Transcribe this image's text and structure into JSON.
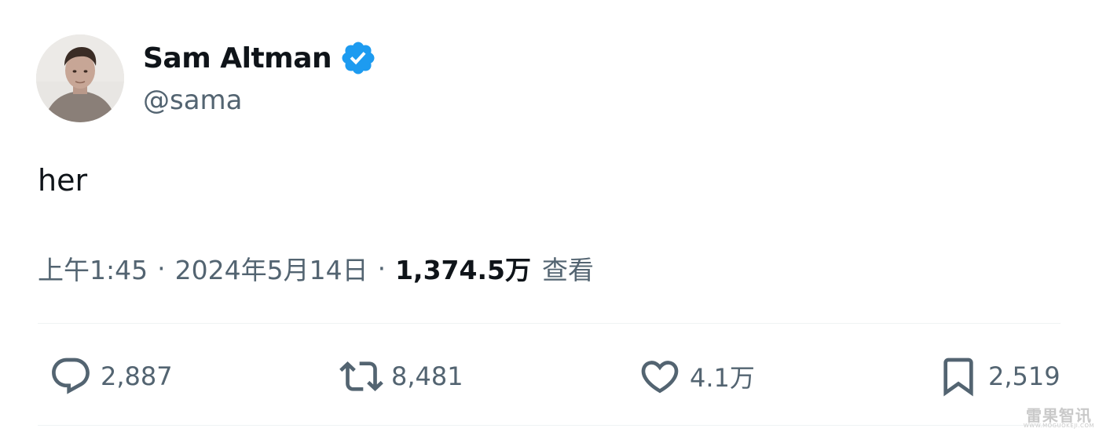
{
  "author": {
    "display_name": "Sam Altman",
    "handle": "@sama",
    "verified": true
  },
  "tweet": {
    "text": "her"
  },
  "meta": {
    "time": "上午1:45",
    "separator": "·",
    "date": "2024年5月14日",
    "views_count": "1,374.5万",
    "views_label": "查看"
  },
  "actions": {
    "replies": "2,887",
    "retweets": "8,481",
    "likes": "4.1万",
    "bookmarks": "2,519"
  },
  "watermark": {
    "text": "雷果智讯",
    "sub": "WWW.MOGUOKEJI.COM"
  },
  "colors": {
    "primary_text": "#0f1419",
    "secondary_text": "#536471",
    "verified_blue": "#1d9bf0",
    "divider": "#eff3f4"
  },
  "icons": {
    "verified": "verified-badge-icon",
    "reply": "reply-icon",
    "retweet": "retweet-icon",
    "like": "heart-icon",
    "bookmark": "bookmark-icon"
  }
}
